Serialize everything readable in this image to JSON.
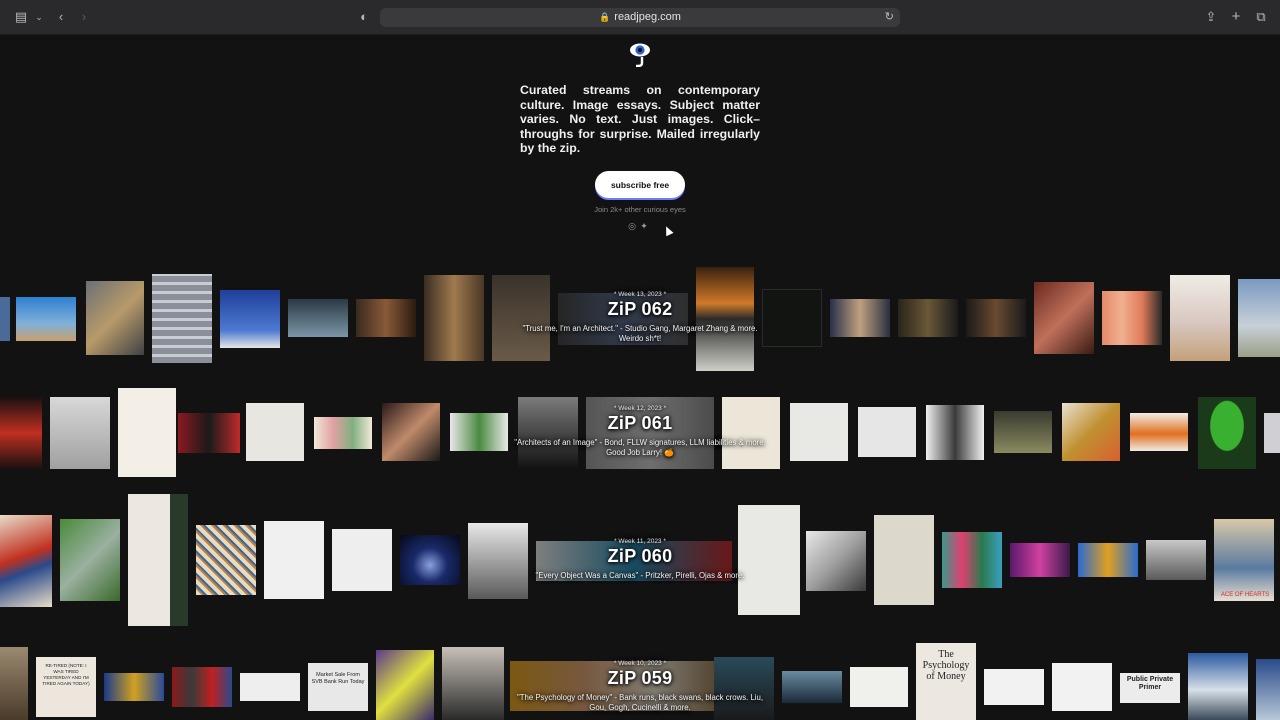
{
  "browser": {
    "url": "readjpeg.com",
    "icons": {
      "sidebar": "sidebar-icon",
      "back": "back-arrow-icon",
      "forward": "forward-arrow-icon",
      "privacy": "shield-icon",
      "lock": "lock-icon",
      "reload": "reload-icon",
      "share": "share-icon",
      "new_tab": "plus-icon",
      "tabs": "tabs-icon"
    }
  },
  "hero": {
    "tagline": "Curated streams on contemporary culture. Image essays. Subject matter varies. No text. Just images. Click–throughs for surprise. Mailed irregularly by the zip.",
    "subscribe_label": "subscribe free",
    "join_text": "Join 2k+ other curious eyes",
    "social": [
      "instagram-icon",
      "twitter-icon"
    ]
  },
  "issues": [
    {
      "week": "* Week 13, 2023 *",
      "title": "ZiP 062",
      "desc": "\"Trust me, I'm an Architect.\" - Studio Gang, Margaret Zhang & more. Weirdo sh*t!"
    },
    {
      "week": "* Week 12, 2023 *",
      "title": "ZiP 061",
      "desc": "\"Architects of an Image\" - Bond, FLLW signatures, LLM liabilities & more. Good Job Larry! 🍊"
    },
    {
      "week": "* Week 11, 2023 *",
      "title": "ZiP 060",
      "desc": "\"Every Object Was a Canvas\" - Pritzker, Pirelli, Ojas & more."
    },
    {
      "week": "* Week 10, 2023 *",
      "title": "ZiP 059",
      "desc": "\"The Psychology of Money\" - Bank runs, black swans, black crows. Liu, Gou, Gogh, Cucinelli & more."
    }
  ],
  "thumb_texts": {
    "psychology": "The Psychology of Money",
    "svb": "Market Sale From SVB Bank Run Today",
    "retired": "RE-TIRED (NOTE: I WAS TIRED YESTERDAY AND I'M TIRED AGAIN TODAY)",
    "public": "Public Private Primer",
    "ace": "ACE OF HEARTS"
  },
  "colors": {
    "background": "#121212",
    "chrome": "#2a2a2c",
    "button": "#ffffff"
  }
}
